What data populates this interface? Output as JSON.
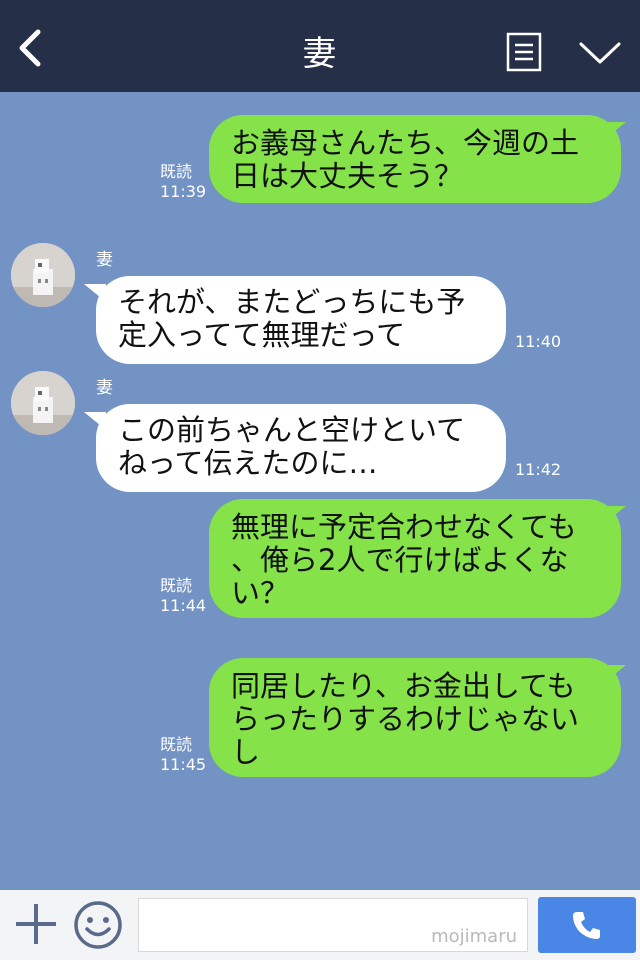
{
  "header": {
    "title": "妻"
  },
  "messages": [
    {
      "dir": "out",
      "text": "お義母さんたち、今週の土\n日は大丈夫そう？",
      "read": "既読",
      "time": "11:39"
    },
    {
      "dir": "in",
      "sender": "妻",
      "text": "それが、またどっちにも予\n定入ってて無理だって",
      "time": "11:40"
    },
    {
      "dir": "in",
      "sender": "妻",
      "text": "この前ちゃんと空けといて\nねって伝えたのに…",
      "time": "11:42"
    },
    {
      "dir": "out",
      "text": "無理に予定合わせなくても\n、俺ら2人で行けばよくな\nい？",
      "read": "既読",
      "time": "11:44"
    },
    {
      "dir": "out",
      "text": "同居したり、お金出しても\nらったりするわけじゃない\nし",
      "read": "既読",
      "time": "11:45"
    }
  ],
  "input": {
    "placeholder": "mojimaru"
  },
  "icons": {
    "back": "chevron-left-icon",
    "note": "note-icon",
    "menu": "chevron-down-icon",
    "plus": "plus-icon",
    "emoji": "smiley-icon",
    "call": "phone-icon"
  },
  "colors": {
    "header": "#252f48",
    "background": "#7393c4",
    "outgoing": "#85e249",
    "incoming": "#ffffff",
    "call_button": "#4a86e5"
  }
}
